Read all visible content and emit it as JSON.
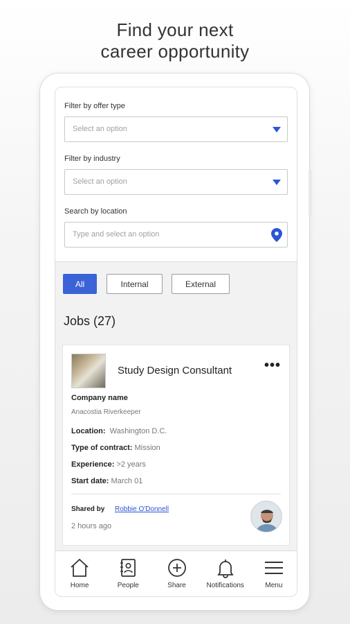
{
  "headline": {
    "line1": "Find your next",
    "line2": "career opportunity"
  },
  "filters": {
    "offer_type": {
      "label": "Filter by offer type",
      "placeholder": "Select an option"
    },
    "industry": {
      "label": "Filter by industry",
      "placeholder": "Select an option"
    },
    "location": {
      "label": "Search by location",
      "placeholder": "Type and select an option"
    }
  },
  "chips": [
    "All",
    "Internal",
    "External"
  ],
  "jobs_title": "Jobs (27)",
  "job": {
    "title": "Study Design Consultant",
    "company_label": "Company name",
    "company_value": "Anacostia Riverkeeper",
    "location_label": "Location:",
    "location_value": "Washington D.C.",
    "contract_label": "Type of contract:",
    "contract_value": "Mission",
    "experience_label": "Experience:",
    "experience_value": ">2 years",
    "start_label": "Start date:",
    "start_value": "March 01",
    "shared_label": "Shared by",
    "shared_name": "Robbie O'Donnell",
    "time": "2 hours ago"
  },
  "tabs": [
    {
      "label": "Home",
      "icon": "home-icon"
    },
    {
      "label": "People",
      "icon": "people-icon"
    },
    {
      "label": "Share",
      "icon": "share-icon"
    },
    {
      "label": "Notifications",
      "icon": "bell-icon"
    },
    {
      "label": "Menu",
      "icon": "menu-icon"
    }
  ],
  "colors": {
    "accent": "#3a63d8",
    "link": "#2c55d6"
  }
}
